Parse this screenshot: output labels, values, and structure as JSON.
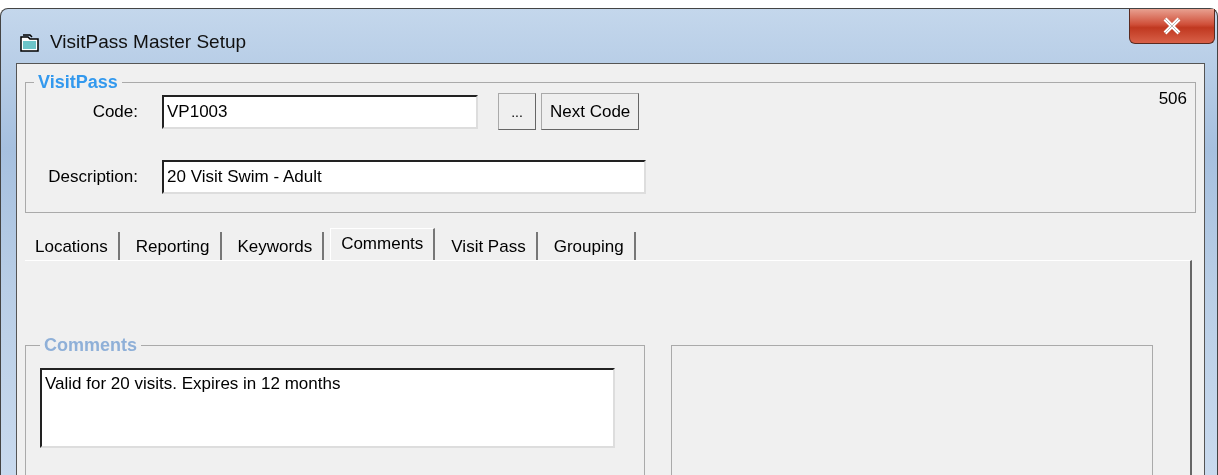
{
  "window": {
    "title": "VisitPass Master Setup"
  },
  "record_number": "506",
  "visitpass_group": {
    "title": "VisitPass",
    "code": {
      "label": "Code:",
      "value": "VP1003"
    },
    "browse_button": "...",
    "next_code_button": "Next Code",
    "description": {
      "label": "Description:",
      "value": "20 Visit Swim - Adult"
    }
  },
  "tabs": [
    {
      "label": "Locations",
      "selected": false
    },
    {
      "label": "Reporting",
      "selected": false
    },
    {
      "label": "Keywords",
      "selected": false
    },
    {
      "label": "Comments",
      "selected": true
    },
    {
      "label": "Visit Pass",
      "selected": false
    },
    {
      "label": "Grouping",
      "selected": false
    }
  ],
  "comments_group": {
    "title": "Comments",
    "value": "Valid for 20 visits. Expires in 12 months"
  }
}
